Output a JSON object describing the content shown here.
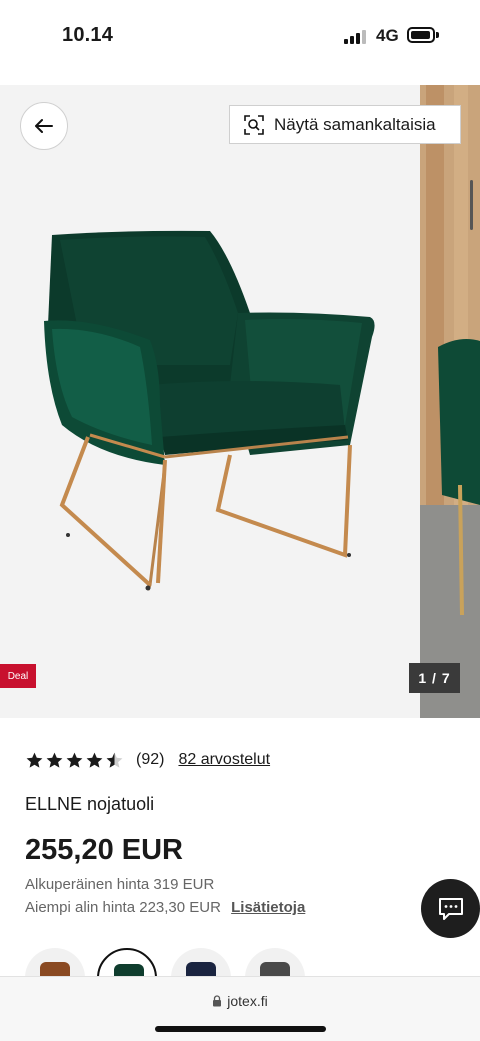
{
  "status_bar": {
    "time": "10.14",
    "network": "4G"
  },
  "gallery": {
    "similar_button_label": "Näytä samankaltaisia",
    "deal_badge": "Deal",
    "image_counter": "1 / 7"
  },
  "product": {
    "rating": 4.5,
    "rating_count": "(92)",
    "reviews_link": "82 arvostelut",
    "title": "ELLNE nojatuoli",
    "price": "255,20 EUR",
    "original_price": "Alkuperäinen hinta 319 EUR",
    "lowest_price": "Aiempi alin hinta 223,30 EUR",
    "more_info_link": "Lisätietoja"
  },
  "swatches": [
    {
      "name": "cognac",
      "color": "#8a4a22"
    },
    {
      "name": "green",
      "color": "#0f3d2e",
      "selected": true
    },
    {
      "name": "navy",
      "color": "#1a2440"
    },
    {
      "name": "grey",
      "color": "#4a4a4a"
    }
  ],
  "browser": {
    "url": "jotex.fi"
  },
  "colors": {
    "deal_red": "#c8102e",
    "chair_green": "#0e4332",
    "leg_gold": "#c48a4e"
  }
}
